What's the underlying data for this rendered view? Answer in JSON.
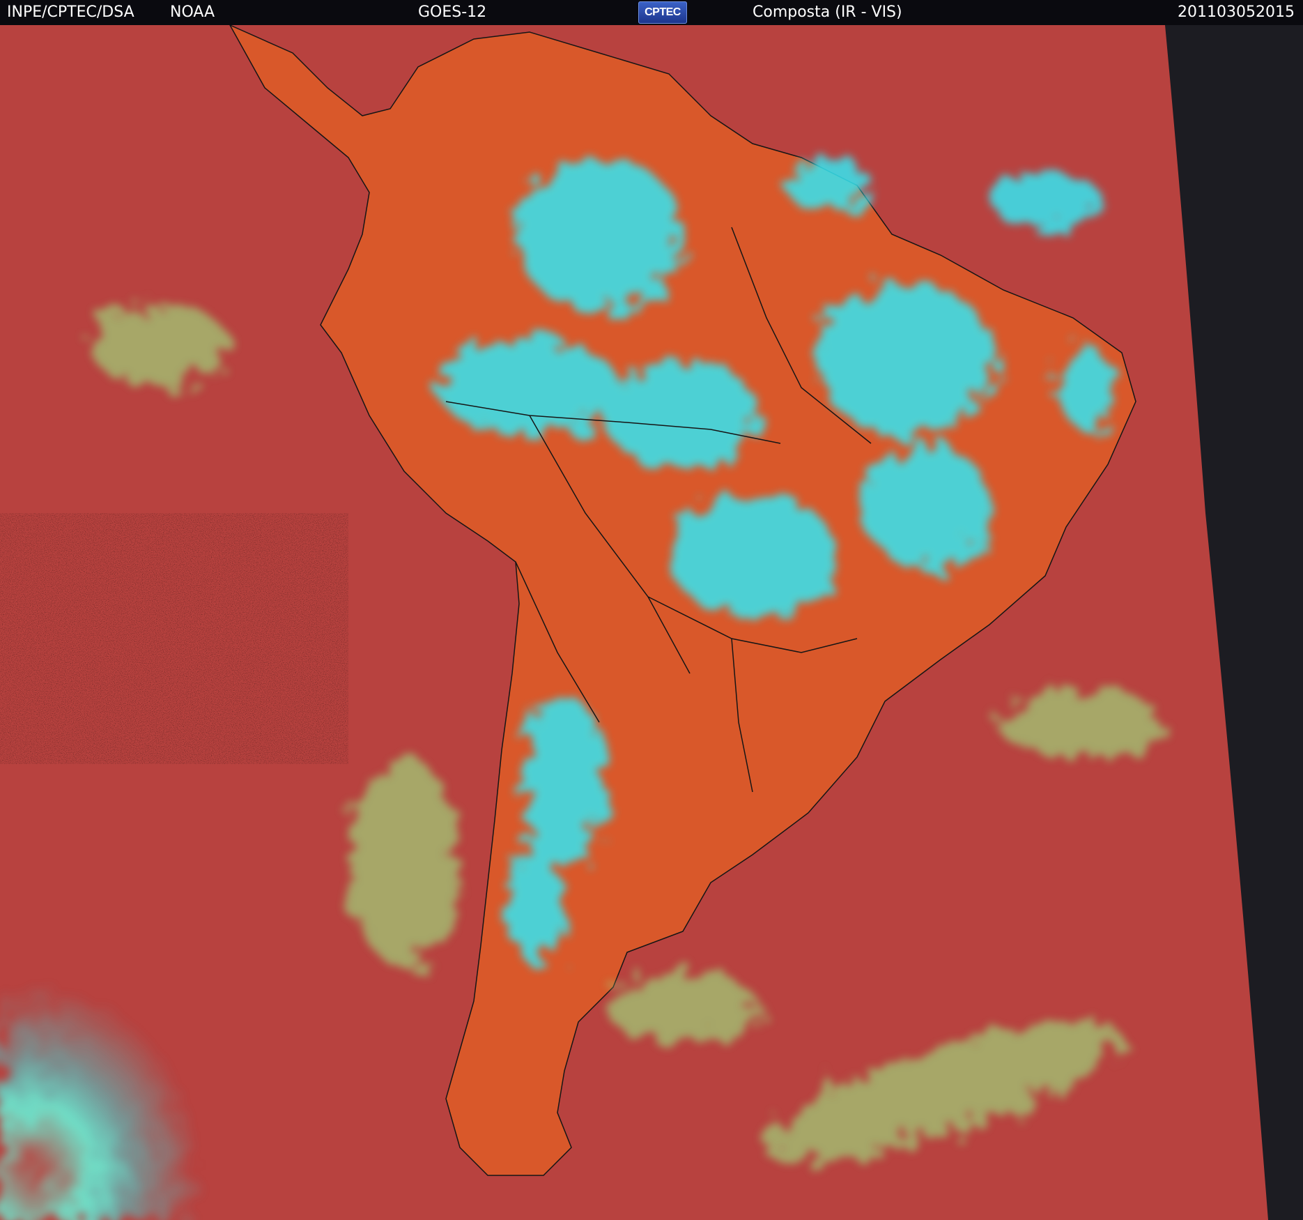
{
  "header": {
    "left_label": "INPE/CPTEC/DSA",
    "agency_label": "NOAA",
    "satellite_label": "GOES-12",
    "logo_text": "CPTEC",
    "product_label": "Composta (IR - VIS)",
    "timestamp": "201103052015"
  },
  "imagery": {
    "colors": {
      "ocean_clear": "#b8423f",
      "land_clear": "#d9582a",
      "cold_cloud": "#35e6f2",
      "low_cloud": "#9fd37a",
      "outside_scan": "#1c1c22",
      "border_lines": "#151515"
    }
  }
}
